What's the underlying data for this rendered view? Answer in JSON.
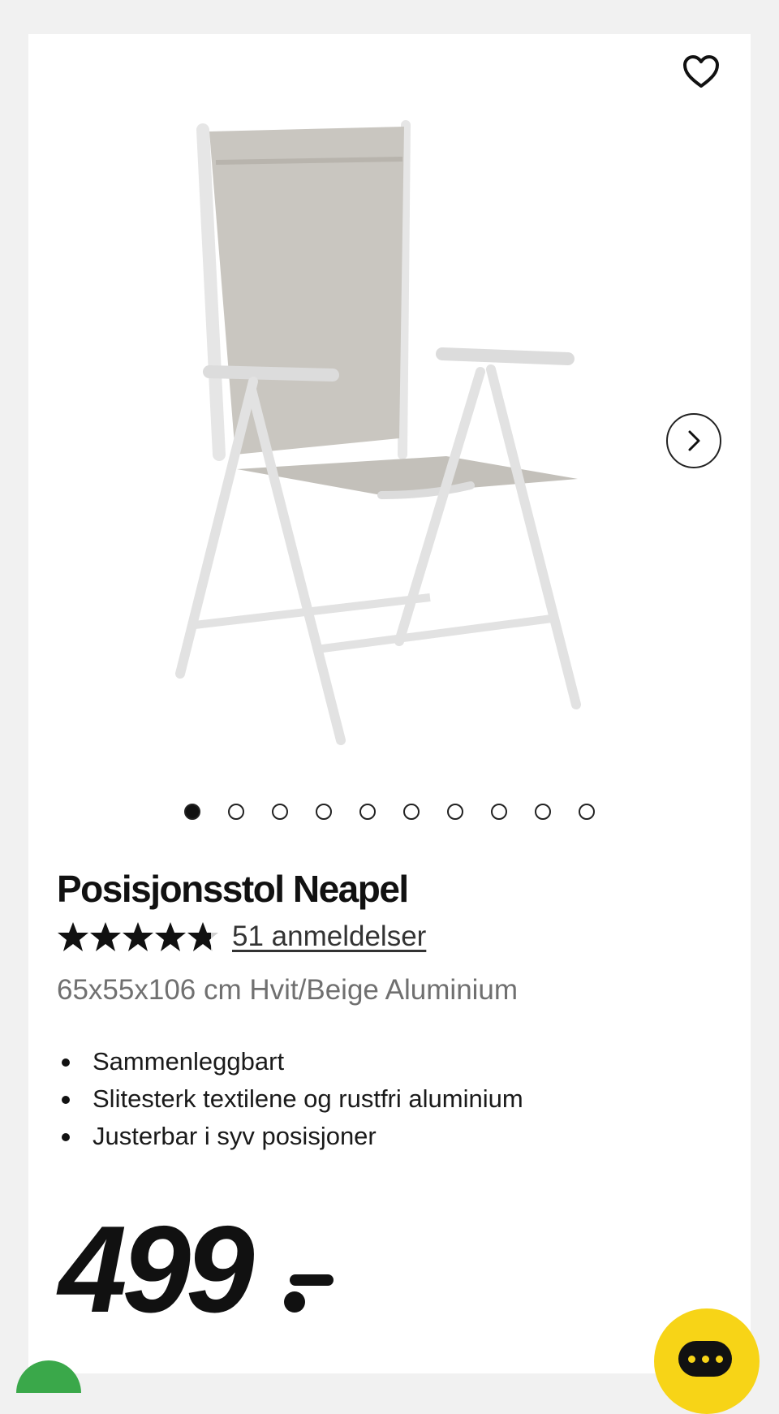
{
  "product": {
    "title": "Posisjonsstol Neapel",
    "rating": 4.8,
    "rating_max": 5,
    "reviews_label": "51 anmeldelser",
    "specs": "65x55x106 cm Hvit/Beige Aluminium",
    "features": [
      "Sammenleggbart",
      "Slitesterk textilene og rustfri aluminium",
      "Justerbar i syv posisjoner"
    ],
    "price": "499"
  },
  "gallery": {
    "image_count": 10,
    "active_index": 0
  },
  "icons": {
    "favorite": "heart-outline-icon",
    "next": "chevron-right-icon",
    "chat": "chat-bubble-icon",
    "star": "star-icon"
  },
  "colors": {
    "chat_button": "#f7d417",
    "page_background": "#f1f1f1",
    "card_background": "#ffffff"
  }
}
